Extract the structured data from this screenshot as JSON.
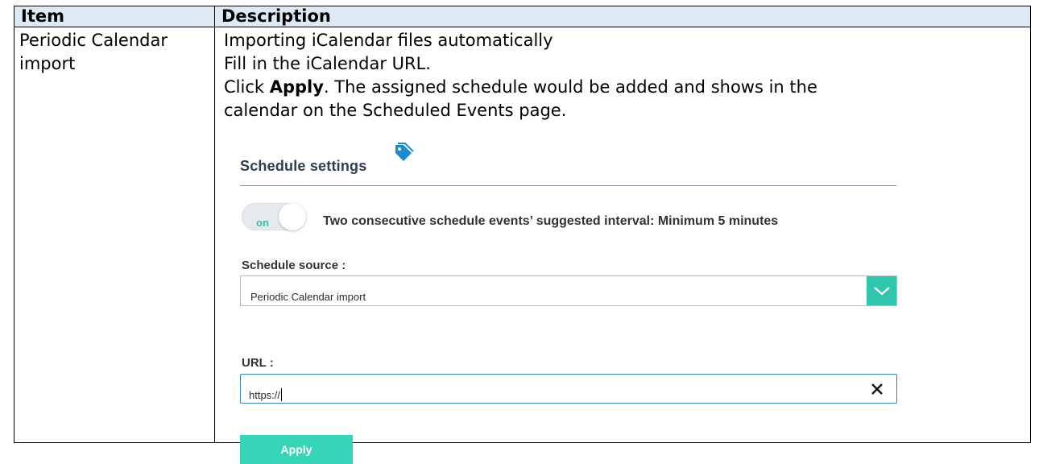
{
  "table": {
    "headers": [
      "Item",
      "Description"
    ],
    "item": [
      "Periodic Calendar",
      "import"
    ],
    "description": {
      "line1": "Importing iCalendar files automatically",
      "line2": "Fill in the iCalendar URL.",
      "line3_prefix": "Click ",
      "line3_bold": "Apply",
      "line3_suffix": ". The assigned schedule would be added and shows in the",
      "line4": "calendar on the Scheduled Events page."
    }
  },
  "ui": {
    "section_title": "Schedule settings",
    "toggle_label": "on",
    "interval_text": "Two consecutive schedule events’ suggested interval: Minimum 5 minutes",
    "schedule_source_label": "Schedule source :",
    "schedule_source_value": "Periodic Calendar import",
    "url_label": "URL :",
    "url_value": "https://",
    "apply_label": "Apply",
    "icons": [
      "tag-icon",
      "chevron-down-icon",
      "close-icon"
    ],
    "colors": {
      "accent": "#2fc6ad",
      "apply_button": "#38d4b8",
      "tag_icon": "#1e8bd0",
      "header_bg": "#dde9f5"
    }
  }
}
